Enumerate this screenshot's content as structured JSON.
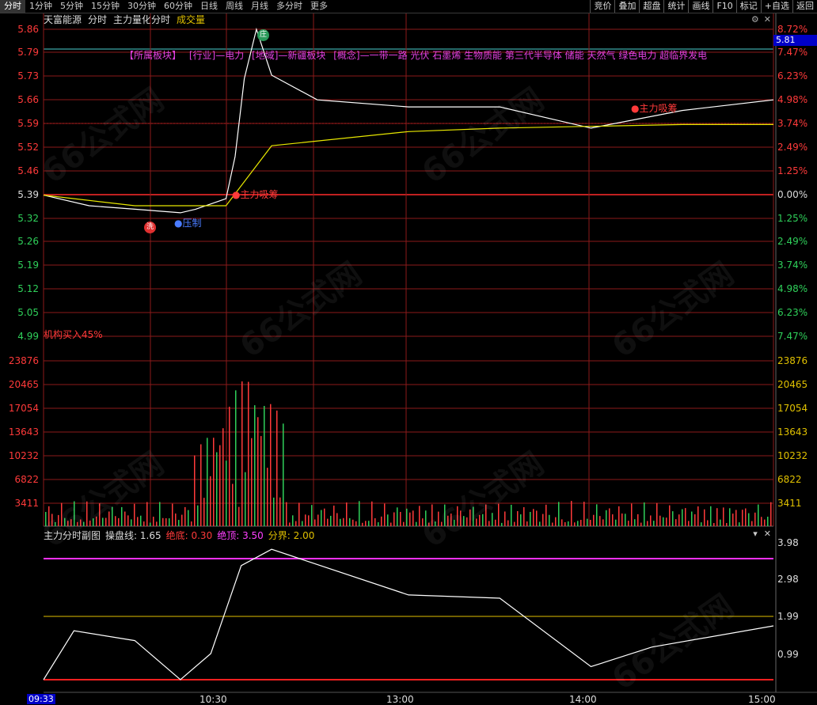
{
  "toolbar": {
    "periods": [
      "分时",
      "1分钟",
      "5分钟",
      "15分钟",
      "30分钟",
      "60分钟",
      "日线",
      "周线",
      "月线",
      "多分时",
      "更多"
    ],
    "actions": [
      "竞价",
      "叠加",
      "超盘",
      "统计",
      "画线",
      "F10",
      "标记",
      "+自选",
      "返回"
    ]
  },
  "header": {
    "stock_name": "天富能源",
    "mode": "分时",
    "indicator": "主力量化分时",
    "volume_label": "成交量"
  },
  "sectors": [
    "【所属板块】",
    "[行业]—电力",
    "[地域]—新疆板块",
    "[概念]—一带一路 光伏 石墨烯 生物质能 第三代半导体 储能 天然气 绿色电力 超临界发电"
  ],
  "price_axis": {
    "left": [
      "5.86",
      "5.79",
      "5.73",
      "5.66",
      "5.59",
      "5.52",
      "5.46",
      "5.39",
      "5.32",
      "5.26",
      "5.19",
      "5.12",
      "5.05",
      "4.99"
    ],
    "right": [
      "8.72%",
      "7.47%",
      "6.23%",
      "4.98%",
      "3.74%",
      "2.49%",
      "1.25%",
      "0.00%",
      "1.25%",
      "2.49%",
      "3.74%",
      "4.98%",
      "6.23%",
      "7.47%"
    ]
  },
  "current_price": "5.81",
  "annotations": {
    "buy1": "主力吸筹",
    "buy2": "主力吸筹",
    "low": "洗",
    "low_note": "压制",
    "top": "庄",
    "inst": "机构买入45%"
  },
  "volume_axis": [
    "23876",
    "20465",
    "17054",
    "13643",
    "10232",
    "6822",
    "3411"
  ],
  "sub_panel": {
    "title": "主力分时副图",
    "line_label": "操盘线:",
    "line_value": "1.65",
    "bottom_label": "绝底:",
    "bottom_value": "0.30",
    "top_label": "绝顶:",
    "top_value": "3.50",
    "divide_label": "分界:",
    "divide_value": "2.00",
    "axis": [
      "3.98",
      "2.98",
      "1.99",
      "0.99"
    ]
  },
  "time_axis": {
    "start": "09:33",
    "ticks": [
      "10:30",
      "13:00",
      "14:00",
      "15:00"
    ]
  },
  "colors": {
    "up": "#ff3a3a",
    "down": "#2fd05a",
    "price_line": "#ffffff",
    "avg_line": "#e8e800",
    "sector": "#e040e0",
    "grid": "#8b1a1a"
  },
  "chart_data": [
    {
      "type": "line",
      "title": "",
      "series": [
        {
          "name": "",
          "x": [
            "09:30",
            "09:45",
            "10:00",
            "10:15",
            "10:20",
            "10:30",
            "10:33",
            "10:36",
            "10:40",
            "10:45",
            "11:00",
            "11:30",
            "13:30",
            "14:00",
            "14:30",
            "15:00"
          ],
          "values": [
            5.39,
            5.36,
            5.35,
            5.34,
            5.35,
            5.38,
            5.5,
            5.72,
            5.86,
            5.73,
            5.66,
            5.64,
            5.64,
            5.58,
            5.63,
            5.66
          ]
        },
        {
          "name": "",
          "x": [
            "09:30",
            "10:00",
            "10:30",
            "10:45",
            "11:30",
            "13:30",
            "14:30",
            "15:00"
          ],
          "values": [
            5.39,
            5.36,
            5.36,
            5.53,
            5.57,
            5.58,
            5.59,
            5.59
          ]
        }
      ],
      "ylim": [
        4.99,
        5.86
      ]
    },
    {
      "type": "bar",
      "title": "",
      "ylim": [
        0,
        23876
      ]
    },
    {
      "type": "line",
      "title": "",
      "series": [
        {
          "name": "操盘线",
          "x": [
            "09:30",
            "09:40",
            "10:00",
            "10:15",
            "10:25",
            "10:35",
            "10:45",
            "11:30",
            "13:30",
            "14:00",
            "14:20",
            "15:00"
          ],
          "values": [
            0.0,
            1.5,
            1.2,
            0.0,
            0.8,
            3.5,
            4.0,
            2.6,
            2.5,
            0.4,
            1.0,
            1.65
          ]
        }
      ],
      "ylim": [
        0,
        4.2
      ]
    }
  ]
}
